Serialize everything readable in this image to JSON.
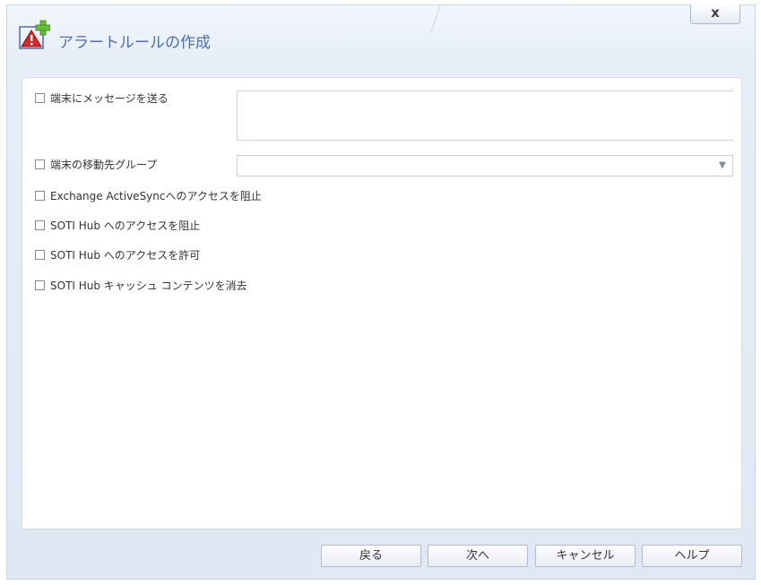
{
  "dialog": {
    "title": "アラートルールの作成",
    "close_label": "x"
  },
  "options": {
    "send_message": "端末にメッセージを送る",
    "move_group": "端末の移動先グループ",
    "block_eas": "Exchange ActiveSyncへのアクセスを阻止",
    "block_hub": "SOTI Hub へのアクセスを阻止",
    "allow_hub": "SOTI Hub へのアクセスを許可",
    "clear_hub_cache": "SOTI Hub キャッシュ コンテンツを消去"
  },
  "message_field": {
    "value": ""
  },
  "group_select": {
    "selected": ""
  },
  "footer": {
    "back": "戻る",
    "next": "次へ",
    "cancel": "キャンセル",
    "help": "ヘルプ"
  },
  "icons": {
    "title_icon": "alert-add-icon",
    "dropdown": "chevron-down-icon"
  }
}
